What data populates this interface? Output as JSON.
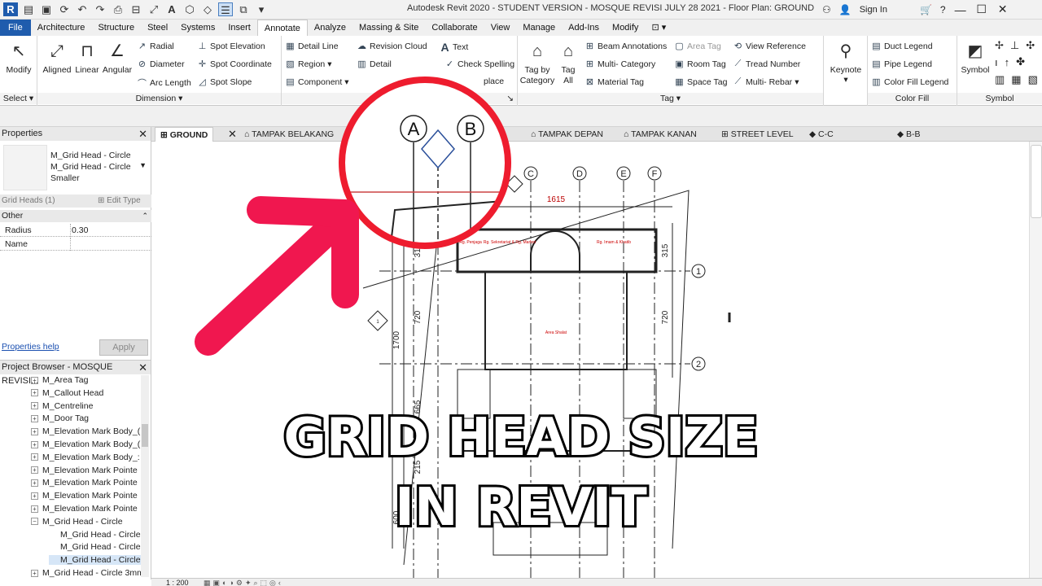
{
  "titlebar": {
    "title": "Autodesk Revit 2020 - STUDENT VERSION - MOSQUE REVISI JULY 28 2021 - Floor Plan: GROUND",
    "sign_in": "Sign In",
    "qat_icons": [
      "revit-logo-icon",
      "open-icon",
      "save-icon",
      "sync-icon",
      "undo-icon",
      "redo-icon",
      "print-icon",
      "measure-icon",
      "text-icon",
      "3d-view-icon",
      "switch-windows-icon"
    ]
  },
  "ribbon_tabs": [
    "File",
    "Architecture",
    "Structure",
    "Steel",
    "Systems",
    "Insert",
    "Annotate",
    "Analyze",
    "Massing & Site",
    "Collaborate",
    "View",
    "Manage",
    "Add-Ins",
    "Modify"
  ],
  "ribbon": {
    "select": {
      "modify": "Modify",
      "label": "Select ▾"
    },
    "dimension": {
      "aligned": "Aligned",
      "linear": "Linear",
      "angular": "Angular",
      "radial": "Radial",
      "diameter": "Diameter",
      "arc_length": "Arc Length",
      "spot_elevation": "Spot Elevation",
      "spot_coordinate": "Spot Coordinate",
      "spot_slope": "Spot Slope",
      "label": "Dimension ▾"
    },
    "detail": {
      "detail_line": "Detail Line",
      "region": "Region",
      "component": "Component",
      "revision_cloud": "Revision Cloud",
      "detail_group": "Detail",
      "text": "Text",
      "check_spelling": "Check Spelling",
      "find_replace": "place"
    },
    "tag": {
      "tag_by_category": "Tag by Category",
      "tag_all": "Tag All",
      "beam_annotations": "Beam Annotations",
      "multi_category": "Multi- Category",
      "material_tag": "Material Tag",
      "area_tag": "Area Tag",
      "room_tag": "Room Tag",
      "space_tag": "Space Tag",
      "view_reference": "View Reference",
      "tread_number": "Tread Number",
      "multi_rebar": "Multi- Rebar",
      "keynote": "Keynote",
      "label": "Tag ▾"
    },
    "color_fill": {
      "duct_legend": "Duct Legend",
      "pipe_legend": "Pipe Legend",
      "color_fill_legend": "Color Fill Legend",
      "label": "Color Fill"
    },
    "symbol": {
      "symbol": "Symbol",
      "label": "Symbol"
    }
  },
  "properties": {
    "header": "Properties",
    "type_name": "M_Grid Head - Circle M_Grid Head - Circle Smaller",
    "instances": "Grid Heads (1)",
    "edit_type": "Edit Type",
    "group": "Other",
    "rows": [
      {
        "key": "Radius",
        "value": "0.30"
      },
      {
        "key": "Name",
        "value": ""
      }
    ],
    "help": "Properties help",
    "apply": "Apply"
  },
  "browser": {
    "header": "Project Browser - MOSQUE REVISI...",
    "items": [
      {
        "label": "M_Area Tag",
        "box": "+",
        "indent": 0
      },
      {
        "label": "M_Callout Head",
        "box": "+",
        "indent": 0
      },
      {
        "label": "M_Centreline",
        "box": "+",
        "indent": 0
      },
      {
        "label": "M_Door Tag",
        "box": "+",
        "indent": 0
      },
      {
        "label": "M_Elevation Mark Body_(",
        "box": "+",
        "indent": 0
      },
      {
        "label": "M_Elevation Mark Body_(",
        "box": "+",
        "indent": 0
      },
      {
        "label": "M_Elevation Mark Body_:",
        "box": "+",
        "indent": 0
      },
      {
        "label": "M_Elevation Mark Pointe",
        "box": "+",
        "indent": 0
      },
      {
        "label": "M_Elevation Mark Pointe",
        "box": "+",
        "indent": 0
      },
      {
        "label": "M_Elevation Mark Pointe",
        "box": "+",
        "indent": 0
      },
      {
        "label": "M_Elevation Mark Pointe",
        "box": "+",
        "indent": 0
      },
      {
        "label": "M_Grid Head - Circle",
        "box": "−",
        "indent": 0
      },
      {
        "label": "M_Grid Head - Circle",
        "box": "",
        "indent": 1
      },
      {
        "label": "M_Grid Head - Circle",
        "box": "",
        "indent": 1
      },
      {
        "label": "M_Grid Head - Circle",
        "box": "",
        "indent": 1
      },
      {
        "label": "M_Grid Head - Circle 3mm",
        "box": "+",
        "indent": 0
      }
    ]
  },
  "view_tabs": [
    "GROUND",
    "TAMPAK BELAKANG",
    "TAMPAK DEPAN",
    "TAMPAK KANAN",
    "STREET LEVEL",
    "C-C",
    "B-B"
  ],
  "drawing": {
    "grid_labels_top": [
      "A",
      "B",
      "C",
      "D",
      "E",
      "F"
    ],
    "grid_labels_side": [
      "1",
      "2"
    ],
    "dimensions": [
      "1615",
      "315",
      "720",
      "1700",
      "315",
      "720",
      "665",
      "215",
      "600"
    ],
    "room_labels": [
      "Rg. Penjaga",
      "Rg. Sekretariat & Rg. Marbot",
      "Rg. Imam & Khatib",
      "Area Shalat"
    ],
    "section_tag": "1"
  },
  "status": {
    "scale": "1 : 200"
  },
  "overlay": {
    "line1": "GRID HEAD SIZE",
    "line2": "IN REVIT"
  },
  "colors": {
    "file_tab": "#1f5cad",
    "highlight_red": "#ee1c2e",
    "arrow_pink": "#f0174f"
  }
}
